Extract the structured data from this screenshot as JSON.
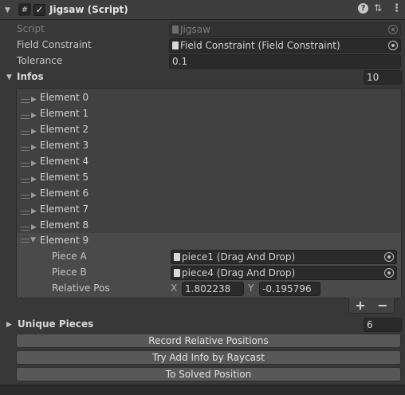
{
  "header": {
    "title": "Jigsaw (Script)",
    "script_glyph": "#",
    "enabled_glyph": "✓",
    "help_glyph": "?",
    "settings_glyph": "⇅",
    "menu_glyph": "⋮"
  },
  "fields": {
    "script": {
      "label": "Script",
      "value": "Jigsaw"
    },
    "field_constraint": {
      "label": "Field Constraint",
      "value": "Field Constraint (Field Constraint)"
    },
    "tolerance": {
      "label": "Tolerance",
      "value": "0.1"
    }
  },
  "infos": {
    "label": "Infos",
    "size": "10",
    "elements": [
      "Element 0",
      "Element 1",
      "Element 2",
      "Element 3",
      "Element 4",
      "Element 5",
      "Element 6",
      "Element 7",
      "Element 8"
    ],
    "expanded": {
      "label": "Element 9",
      "piece_a": {
        "label": "Piece A",
        "value": "piece1 (Drag And Drop)"
      },
      "piece_b": {
        "label": "Piece B",
        "value": "piece4 (Drag And Drop)"
      },
      "relative_pos": {
        "label": "Relative Pos",
        "x_label": "X",
        "x": "1.802238",
        "y_label": "Y",
        "y": "-0.195796"
      }
    },
    "add_glyph": "+",
    "remove_glyph": "−"
  },
  "unique_pieces": {
    "label": "Unique Pieces",
    "size": "6"
  },
  "buttons": {
    "record": "Record Relative Positions",
    "raycast": "Try Add Info by Raycast",
    "solved": "To Solved Position"
  },
  "glyphs": {
    "collapsed": "▶",
    "expanded": "▼"
  }
}
